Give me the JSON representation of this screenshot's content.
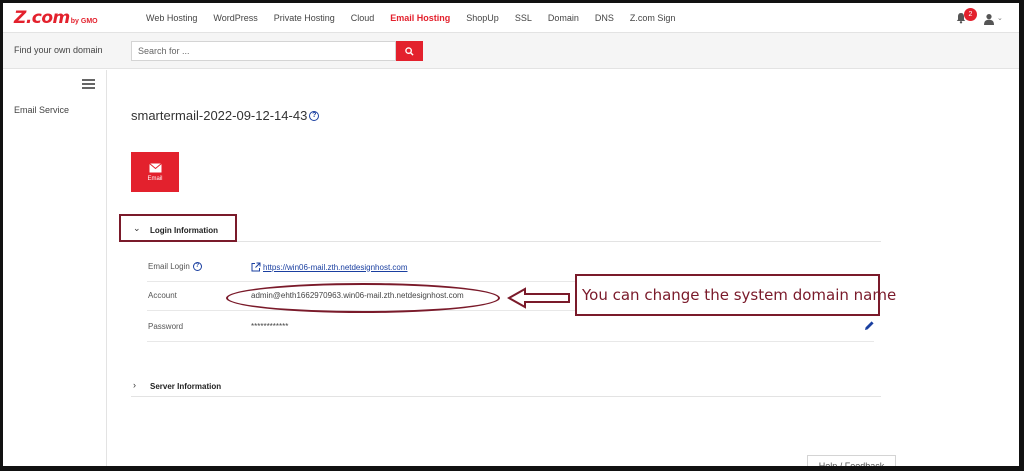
{
  "brand": {
    "logo_main": "Z.com",
    "logo_sub": "by GMO"
  },
  "nav": {
    "items": [
      "Web Hosting",
      "WordPress",
      "Private Hosting",
      "Cloud",
      "Email Hosting",
      "ShopUp",
      "SSL",
      "Domain",
      "DNS",
      "Z.com Sign"
    ],
    "active": "Email Hosting",
    "notification_count": "2"
  },
  "search": {
    "label": "Find your own domain",
    "placeholder": "Search for ..."
  },
  "sidebar": {
    "items": [
      {
        "label": "Email Service"
      }
    ]
  },
  "page": {
    "title": "smartermail-2022-09-12-14-43",
    "tile_label": "Email"
  },
  "login_info": {
    "title": "Login Information",
    "rows": [
      {
        "label": "Email Login",
        "value": "https://win06-mail.zth.netdesignhost.com"
      },
      {
        "label": "Account",
        "value": "admin@ehth1662970963.win06-mail.zth.netdesignhost.com"
      },
      {
        "label": "Password",
        "value": "************"
      }
    ]
  },
  "server_info": {
    "title": "Server Information"
  },
  "annotation": {
    "text": "You can change the system domain name"
  },
  "footer": {
    "help_label": "Help / Feedback"
  },
  "colors": {
    "brand_red": "#e3212d",
    "annotation": "#7a1a2a",
    "link": "#1a3fa0"
  }
}
